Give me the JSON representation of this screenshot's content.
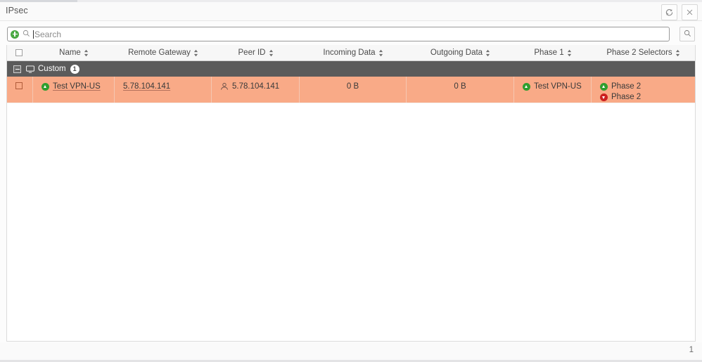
{
  "window": {
    "title": "IPsec",
    "refresh_icon": "refresh-icon",
    "close_icon": "close-icon"
  },
  "search": {
    "add_icon": "add-circle-icon",
    "magnifier_icon": "search-icon",
    "placeholder": "Search",
    "value": "",
    "submit_icon": "search-icon"
  },
  "table": {
    "select_all_checkbox": "",
    "columns": [
      {
        "label": "",
        "name": "select-all"
      },
      {
        "label": "Name",
        "name": "name",
        "sortable": true
      },
      {
        "label": "Remote Gateway",
        "name": "remote-gateway",
        "sortable": true
      },
      {
        "label": "Peer ID",
        "name": "peer-id",
        "sortable": true
      },
      {
        "label": "Incoming Data",
        "name": "incoming-data",
        "sortable": true
      },
      {
        "label": "Outgoing Data",
        "name": "outgoing-data",
        "sortable": true
      },
      {
        "label": "Phase 1",
        "name": "phase-1",
        "sortable": true
      },
      {
        "label": "Phase 2 Selectors",
        "name": "phase-2-selectors",
        "sortable": true
      }
    ],
    "group": {
      "icon": "monitor-icon",
      "label": "Custom",
      "count": "1",
      "collapse_icon": "collapse-minus-icon"
    },
    "rows": [
      {
        "name": "Test VPN-US",
        "name_status": "up",
        "remote_gateway": "5.78.104.141",
        "peer_id": "5.78.104.141",
        "peer_id_icon": "user-icon",
        "incoming_data": "0 B",
        "outgoing_data": "0 B",
        "phase1": "Test VPN-US",
        "phase1_status": "up",
        "phase2": [
          {
            "label": "Phase 2",
            "status": "up"
          },
          {
            "label": "Phase 2",
            "status": "down"
          }
        ]
      }
    ]
  },
  "footer": {
    "count": "1"
  },
  "colors": {
    "row_highlight": "#f9aa87",
    "group_header": "#5b5b5b",
    "status_up": "#2f9e2f",
    "status_down": "#cc2020",
    "accent_green": "#49a942"
  }
}
